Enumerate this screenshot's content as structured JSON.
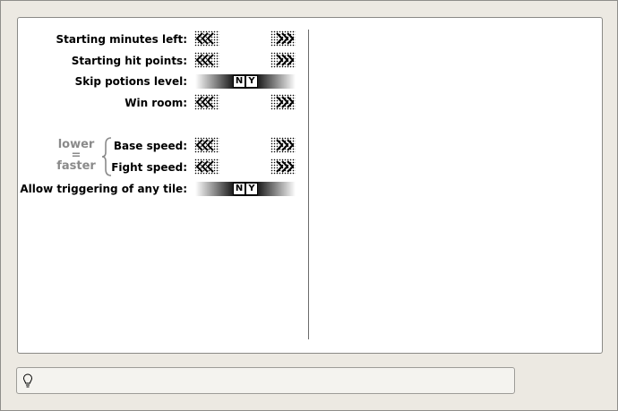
{
  "settings": {
    "starting_minutes_label": "Starting minutes left:",
    "starting_hp_label": "Starting hit points:",
    "skip_potions_label": "Skip potions level:",
    "win_room_label": "Win room:",
    "base_speed_label": "Base speed:",
    "fight_speed_label": "Fight speed:",
    "allow_trigger_label": "Allow triggering of any tile:"
  },
  "toggle": {
    "no": "N",
    "yes": "Y"
  },
  "hint": {
    "line1": "lower",
    "line2": "=",
    "line3": "faster"
  },
  "icons": {
    "decrease": "double-left-arrow-icon",
    "increase": "double-right-arrow-icon",
    "status": "lightbulb-icon"
  },
  "colors": {
    "background": "#ece9e2",
    "panel": "#ffffff",
    "hint": "#8a8a8a"
  }
}
